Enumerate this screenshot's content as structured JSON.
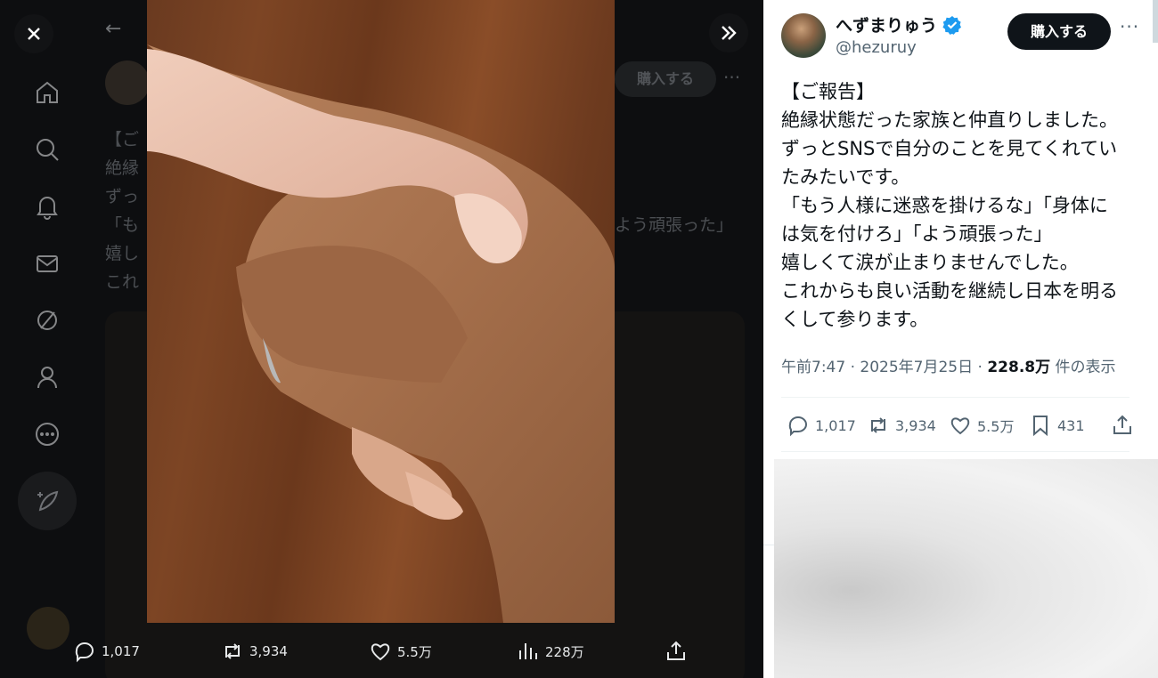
{
  "media_viewer": {
    "close_icon": "close-icon",
    "collapse_icon": "chevrons-right-icon",
    "actions": {
      "replies": "1,017",
      "reposts": "3,934",
      "likes": "5.5万",
      "views": "228万"
    }
  },
  "background_post": {
    "buy_label": "購入する",
    "lines": [
      "【ご",
      "絶縁",
      "ずっ",
      "「も",
      "嬉し",
      "これ"
    ],
    "tail": "よう頑張った」"
  },
  "post": {
    "author_name": "へずまりゅう",
    "handle": "@hezuruy",
    "verified": true,
    "buy_label": "購入する",
    "more_label": "···",
    "body_lines": [
      "【ご報告】",
      "絶縁状態だった家族と仲直りしました。",
      "ずっとSNSで自分のことを見てくれてい",
      "たみたいです。",
      "「もう人様に迷惑を掛けるな」「身体に",
      "は気を付けろ」「よう頑張った」",
      "嬉しくて涙が止まりませんでした。",
      "これからも良い活動を継続し日本を明る",
      "くして参ります。"
    ],
    "time": "午前7:47",
    "dot": "·",
    "date": "2025年7月25日",
    "views_count": "228.8万",
    "views_label": "件の表示",
    "actions": {
      "replies": "1,017",
      "reposts": "3,934",
      "likes": "5.5万",
      "bookmarks": "431"
    }
  },
  "colors": {
    "accent_verified": "#1d9bf0",
    "dark_button": "#0f1419",
    "muted_text": "#536471"
  }
}
